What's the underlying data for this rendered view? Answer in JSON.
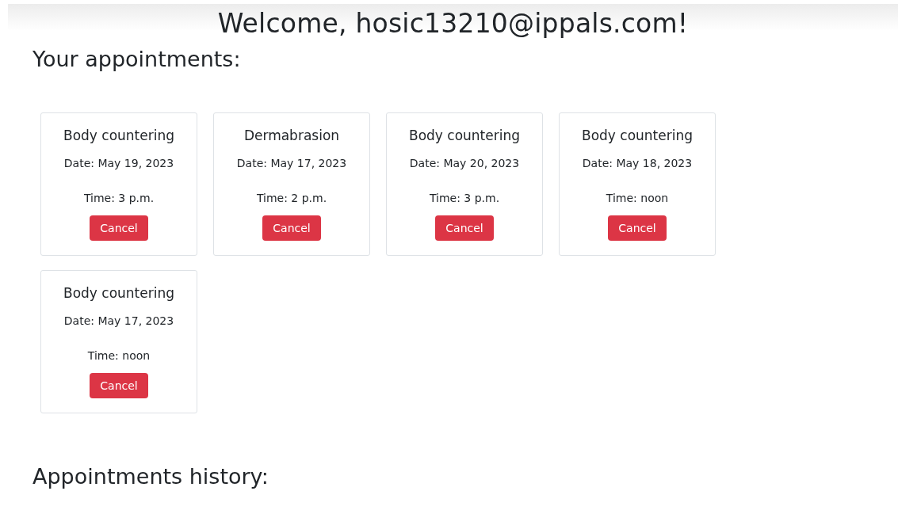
{
  "header": {
    "title": "Welcome, hosic13210@ippals.com!"
  },
  "appointments_heading": "Your appointments:",
  "appointments": [
    {
      "service": "Body countering",
      "date": "Date: May 19, 2023",
      "time": "Time: 3 p.m.",
      "action": "Cancel"
    },
    {
      "service": "Dermabrasion",
      "date": "Date: May 17, 2023",
      "time": "Time: 2 p.m.",
      "action": "Cancel"
    },
    {
      "service": "Body countering",
      "date": "Date: May 20, 2023",
      "time": "Time: 3 p.m.",
      "action": "Cancel"
    },
    {
      "service": "Body countering",
      "date": "Date: May 18, 2023",
      "time": "Time: noon",
      "action": "Cancel"
    },
    {
      "service": "Body countering",
      "date": "Date: May 17, 2023",
      "time": "Time: noon",
      "action": "Cancel"
    }
  ],
  "history_heading": "Appointments history:"
}
